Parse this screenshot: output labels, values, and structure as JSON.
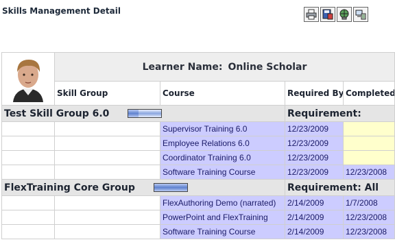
{
  "page": {
    "title": "Skills Management Detail"
  },
  "toolbar": {
    "buttons": [
      {
        "icon": "printer-icon"
      },
      {
        "icon": "save-disk-icon"
      },
      {
        "icon": "network-globe-icon"
      },
      {
        "icon": "computer-export-icon"
      }
    ]
  },
  "learner": {
    "label": "Learner Name:",
    "name": "Online Scholar"
  },
  "columns": {
    "skill_group": "Skill Group",
    "course": "Course",
    "required_by": "Required By",
    "completed": "Completed"
  },
  "groups": [
    {
      "name": "Test Skill Group 6.0",
      "progress": 0.3,
      "requirement": "Requirement:",
      "courses": [
        {
          "course": "Supervisor Training 6.0",
          "required_by": "12/23/2009",
          "completed": ""
        },
        {
          "course": "Employee Relations 6.0",
          "required_by": "12/23/2009",
          "completed": ""
        },
        {
          "course": "Coordinator Training 6.0",
          "required_by": "12/23/2009",
          "completed": ""
        },
        {
          "course": "Software Training Course",
          "required_by": "12/23/2009",
          "completed": "12/23/2008"
        }
      ]
    },
    {
      "name": "FlexTraining Core Group",
      "progress": 1.0,
      "requirement": "Requirement: All",
      "courses": [
        {
          "course": "FlexAuthoring Demo (narrated)",
          "required_by": "2/14/2009",
          "completed": "1/7/2008"
        },
        {
          "course": "PowerPoint and FlexTraining",
          "required_by": "2/14/2009",
          "completed": "12/23/2008"
        },
        {
          "course": "Software Training Course",
          "required_by": "2/14/2009",
          "completed": "12/23/2008"
        }
      ]
    }
  ],
  "colors": {
    "header_gray": "#eeeeee",
    "group_gray": "#e5e5e5",
    "course_lavender": "#ccccff",
    "pending_yellow": "#ffffcc"
  }
}
